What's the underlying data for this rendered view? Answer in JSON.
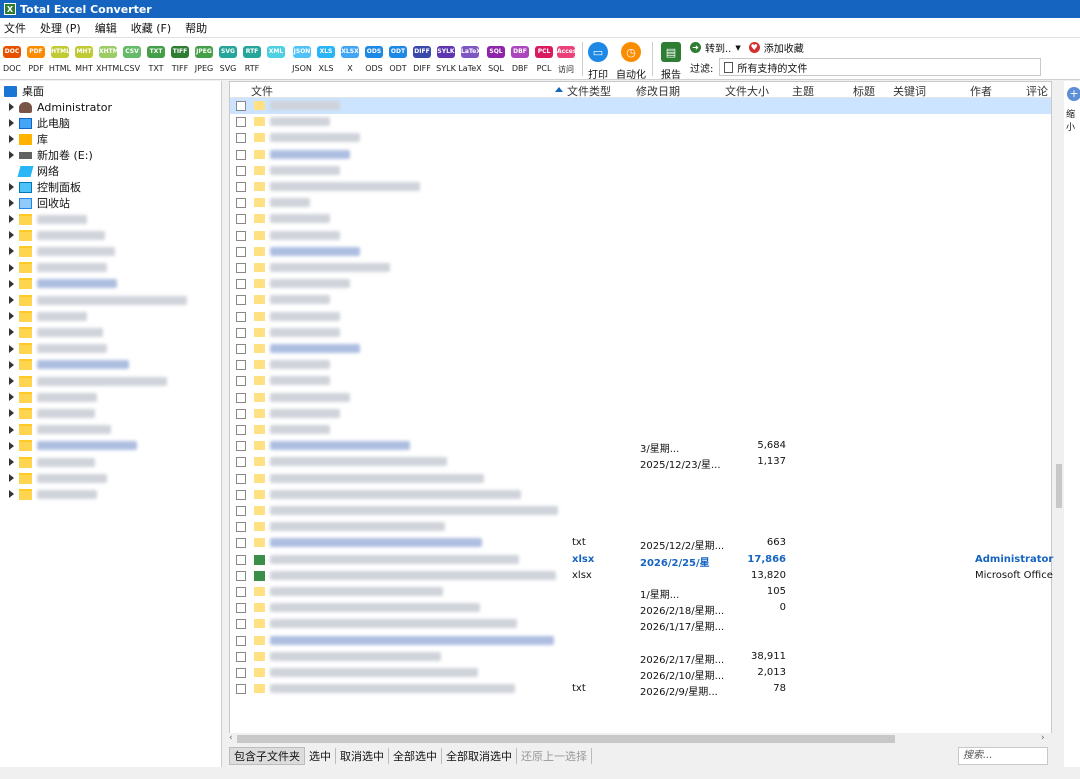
{
  "window": {
    "title": "Total Excel Converter"
  },
  "menu": [
    "文件",
    "处理 (P)",
    "编辑",
    "收藏 (F)",
    "帮助"
  ],
  "formats": [
    {
      "badge": "DOC",
      "label": "DOC",
      "color": "#e65100"
    },
    {
      "badge": "PDF",
      "label": "PDF",
      "color": "#fb8c00"
    },
    {
      "badge": "HTML",
      "label": "HTML",
      "color": "#c0ca33"
    },
    {
      "badge": "MHT",
      "label": "MHT",
      "color": "#c0ca33"
    },
    {
      "badge": "XHTML",
      "label": "XHTML",
      "color": "#9ccc65"
    },
    {
      "badge": "CSV",
      "label": "CSV",
      "color": "#66bb6a"
    },
    {
      "badge": "TXT",
      "label": "TXT",
      "color": "#43a047"
    },
    {
      "badge": "TIFF",
      "label": "TIFF",
      "color": "#2e7d32"
    },
    {
      "badge": "JPEG",
      "label": "JPEG",
      "color": "#43a047"
    },
    {
      "badge": "SVG",
      "label": "SVG",
      "color": "#26a69a"
    },
    {
      "badge": "RTF",
      "label": "RTF",
      "color": "#26a69a"
    },
    {
      "badge": "XML",
      "label": "",
      "color": "#4dd0e1"
    },
    {
      "badge": "JSON",
      "label": "JSON",
      "color": "#4fc3f7"
    },
    {
      "badge": "XLS",
      "label": "XLS",
      "color": "#29b6f6"
    },
    {
      "badge": "XLSX",
      "label": "X",
      "color": "#42a5f5"
    },
    {
      "badge": "ODS",
      "label": "ODS",
      "color": "#1e88e5"
    },
    {
      "badge": "ODT",
      "label": "ODT",
      "color": "#1e88e5"
    },
    {
      "badge": "DIFF",
      "label": "DIFF",
      "color": "#3949ab"
    },
    {
      "badge": "SYLK",
      "label": "SYLK",
      "color": "#5e35b1"
    },
    {
      "badge": "LaTeX",
      "label": "LaTeX",
      "color": "#7e57c2"
    },
    {
      "badge": "SQL",
      "label": "SQL",
      "color": "#8e24aa"
    },
    {
      "badge": "DBF",
      "label": "DBF",
      "color": "#ab47bc"
    },
    {
      "badge": "PCL",
      "label": "PCL",
      "color": "#d81b60"
    },
    {
      "badge": "Access",
      "label": "访问",
      "color": "#ec407a"
    }
  ],
  "actions": {
    "print": "打印",
    "automate": "自动化",
    "report": "报告",
    "goto": "转到..",
    "add_favorite": "添加收藏",
    "filter_label": "过滤:",
    "filter_value": "所有支持的文件"
  },
  "tree": [
    {
      "label": "桌面",
      "icon": "desktop-icon"
    },
    {
      "label": "Administrator",
      "icon": "user-icon"
    },
    {
      "label": "此电脑",
      "icon": "computer-icon"
    },
    {
      "label": "库",
      "icon": "library-icon"
    },
    {
      "label": "新加卷 (E:)",
      "icon": "drive-icon"
    },
    {
      "label": "网络",
      "icon": "network-icon"
    },
    {
      "label": "控制面板",
      "icon": "control-panel-icon"
    },
    {
      "label": "回收站",
      "icon": "recycle-bin-icon"
    }
  ],
  "columns": {
    "name": "文件",
    "type": "文件类型",
    "modified": "修改日期",
    "size": "文件大小",
    "subject": "主题",
    "title": "标题",
    "keywords": "关键词",
    "author": "作者",
    "comments": "评论"
  },
  "file_rows": [
    {
      "type": "",
      "date": "3/星期...",
      "size": "5,684",
      "author": ""
    },
    {
      "type": "",
      "date": "2025/12/23/星...",
      "size": "1,137",
      "author": ""
    },
    {
      "type": "",
      "date": "",
      "size": "",
      "author": ""
    },
    {
      "type": "",
      "date": "",
      "size": "",
      "author": ""
    },
    {
      "type": "",
      "date": "",
      "size": "",
      "author": ""
    },
    {
      "type": "",
      "date": "",
      "size": "",
      "author": ""
    },
    {
      "type": "txt",
      "date": "2025/12/2/星期...",
      "size": "663",
      "author": ""
    },
    {
      "type": "xlsx",
      "date": "2026/2/25/星",
      "size": "17,866",
      "author": "Administrator",
      "bold": true
    },
    {
      "type": "xlsx",
      "date": "",
      "size": "13,820",
      "author": "Microsoft Office U"
    },
    {
      "type": "",
      "date": "1/星期...",
      "size": "105",
      "author": ""
    },
    {
      "type": "",
      "date": "2026/2/18/星期...",
      "size": "0",
      "author": ""
    },
    {
      "type": "",
      "date": "2026/1/17/星期...",
      "size": "",
      "author": ""
    },
    {
      "type": "",
      "date": "",
      "size": "",
      "author": ""
    },
    {
      "type": "",
      "date": "2026/2/17/星期...",
      "size": "38,911",
      "author": ""
    },
    {
      "type": "",
      "date": "2026/2/10/星期...",
      "size": "2,013",
      "author": ""
    },
    {
      "type": "txt",
      "date": "2026/2/9/星期...",
      "size": "78",
      "author": ""
    }
  ],
  "bottom_actions": [
    "包含子文件夹",
    "选中",
    "取消选中",
    "全部选中",
    "全部取消选中",
    "还原上一选择"
  ],
  "search_placeholder": "搜索...",
  "side_panel": {
    "zoom_label": "缩小"
  }
}
